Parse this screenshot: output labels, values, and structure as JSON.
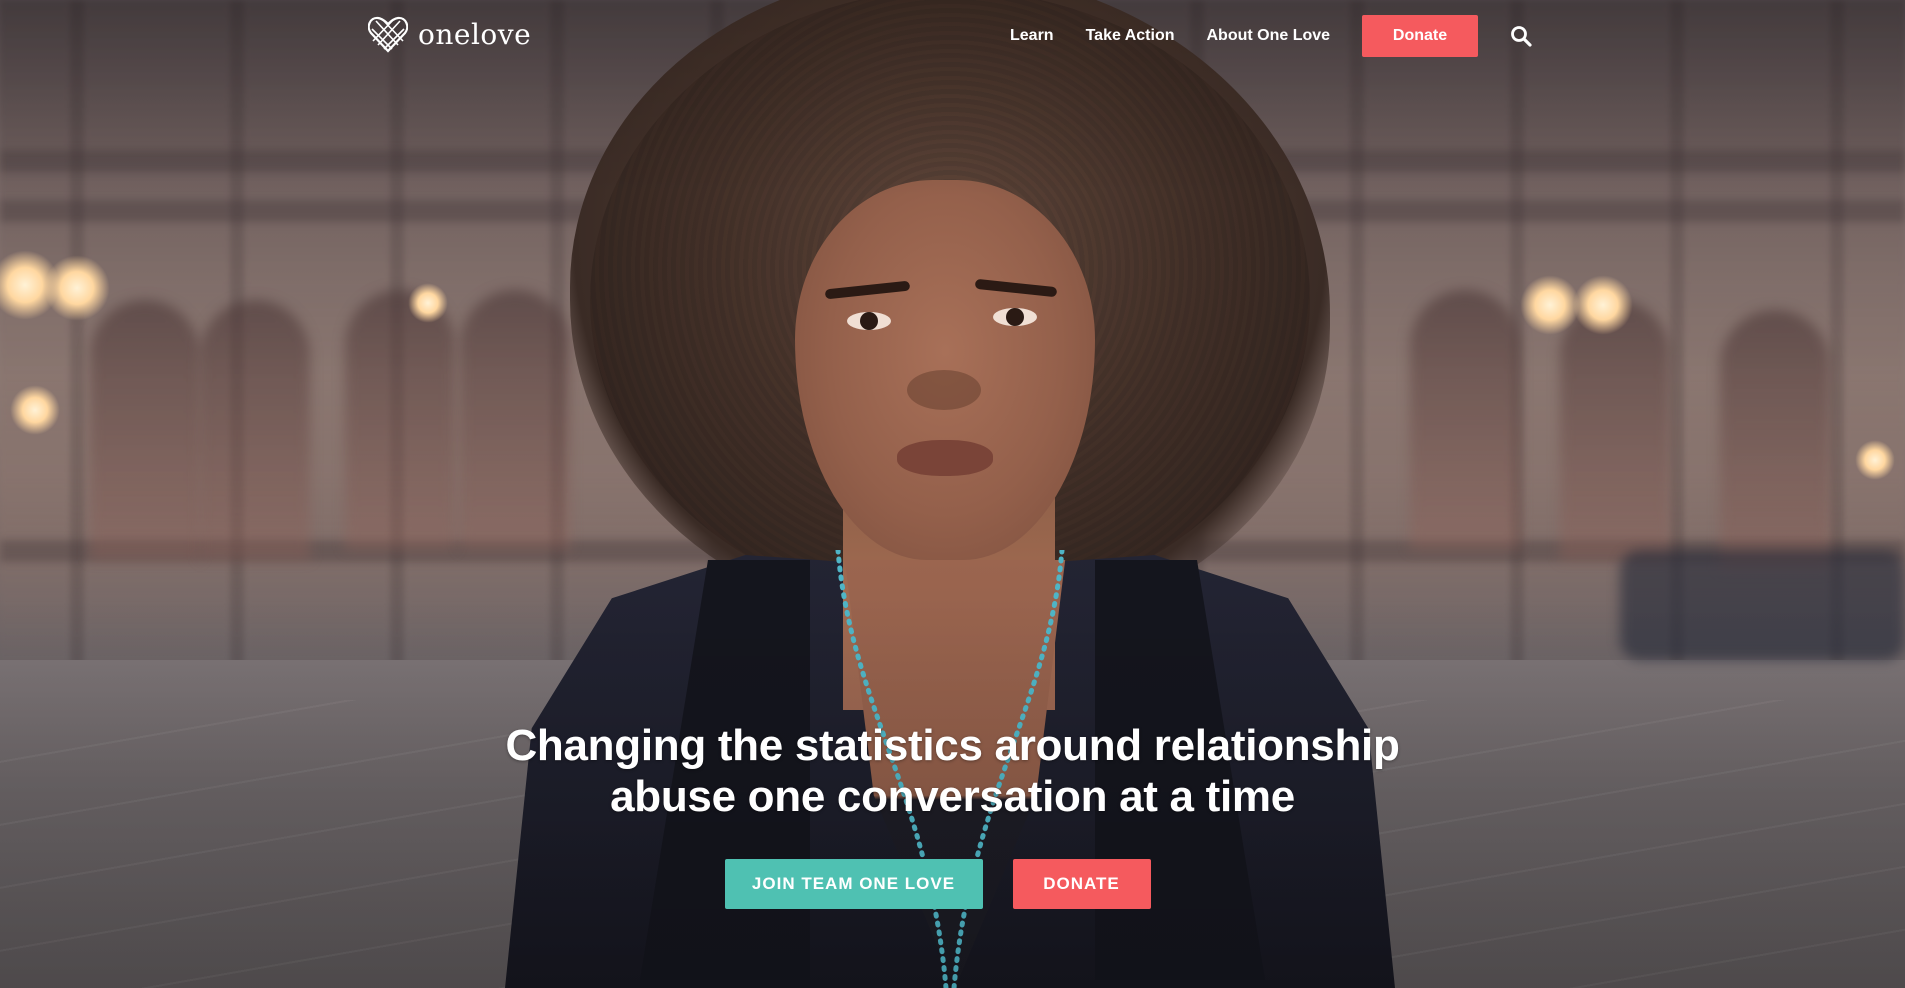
{
  "brand": {
    "name": "onelove",
    "logo_icon": "heart-lattice-icon"
  },
  "nav": {
    "items": [
      {
        "label": "Learn"
      },
      {
        "label": "Take Action"
      },
      {
        "label": "About One Love"
      }
    ],
    "donate_label": "Donate",
    "search_icon": "search-icon"
  },
  "hero": {
    "headline_line1": "Changing the statistics around relationship",
    "headline_line2": "abuse one conversation at a time",
    "primary_cta": "JOIN TEAM ONE LOVE",
    "secondary_cta": "DONATE"
  },
  "colors": {
    "accent_red": "#f55a5e",
    "accent_teal": "#4fc1b2",
    "text": "#ffffff"
  }
}
